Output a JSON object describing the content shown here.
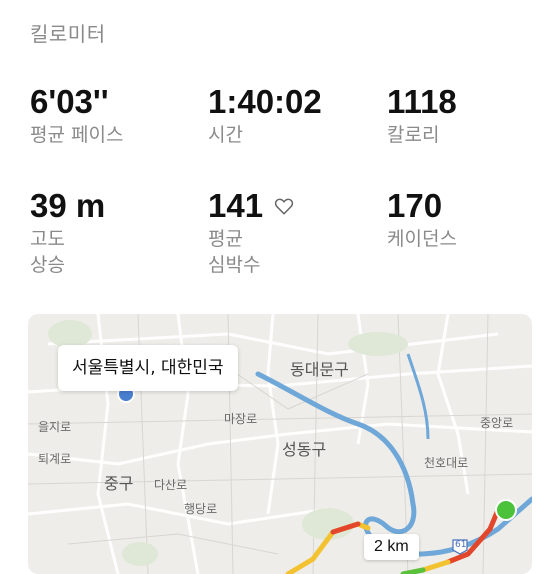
{
  "header": {
    "unit_label": "킬로미터"
  },
  "stats": [
    {
      "value": "6'03''",
      "label": "평균 페이스"
    },
    {
      "value": "1:40:02",
      "label": "시간"
    },
    {
      "value": "1118",
      "label": "칼로리"
    },
    {
      "value": "39 m",
      "label": "고도\n상승"
    },
    {
      "value": "141",
      "label": "평균\n심박수",
      "icon": "heart-outline-icon"
    },
    {
      "value": "170",
      "label": "케이던스"
    }
  ],
  "map": {
    "location": "서울특별시, 대한민국",
    "distance_marker": "2 km",
    "labels": {
      "dongdaemun": "동대문구",
      "seongdong": "성동구",
      "junggu": "중구",
      "majang": "마장로",
      "eulji": "을지로",
      "toegye": "퇴계로",
      "dasan": "다산로",
      "haengdang": "행당로",
      "cheonho": "천호대로",
      "jungang": "중앙로",
      "route_sign": "61"
    },
    "colors": {
      "river": "#6fa8d8",
      "route_red": "#e2462b",
      "route_yellow": "#f2c230",
      "route_green": "#5cc13a",
      "start_dot": "#4cc23a"
    }
  }
}
